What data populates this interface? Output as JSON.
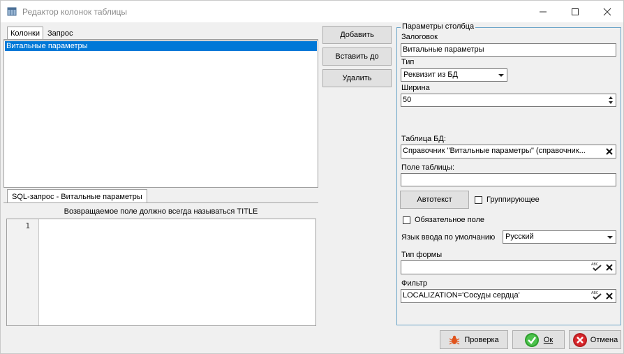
{
  "window": {
    "title": "Редактор колонок таблицы"
  },
  "left_tabs": [
    "Колонки",
    "Запрос"
  ],
  "columns_list": {
    "items": [
      "Витальные параметры"
    ]
  },
  "sql_tab": {
    "label": "SQL-запрос - Витальные параметры",
    "hint": "Возвращаемое поле должно всегда называться TITLE",
    "line_number": "1",
    "code": ""
  },
  "middle_buttons": {
    "add": "Добавить",
    "insert_before": "Вставить до",
    "delete": "Удалить"
  },
  "params": {
    "group_title": "Параметры столбца",
    "header_label": "Залоговок",
    "header_value": "Витальные параметры",
    "type_label": "Тип",
    "type_value": "Реквизит из БД",
    "width_label": "Ширина",
    "width_value": "50",
    "db_table_label": "Таблица БД:",
    "db_table_value": "Справочник \"Витальные параметры\" (справочник...",
    "table_field_label": "Поле таблицы:",
    "table_field_value": "",
    "autotext_button": "Автотекст",
    "grouping_label": "Группирующее",
    "grouping_checked": false,
    "required_label": "Обязательное поле",
    "required_checked": false,
    "input_lang_label": "Язык ввода по умолчанию",
    "input_lang_value": "Русский",
    "form_type_label": "Тип формы",
    "form_type_value": "",
    "filter_label": "Фильтр",
    "filter_value": "LOCALIZATION='Сосуды сердца'"
  },
  "bottom_buttons": {
    "check": "Проверка",
    "ok": "Ок",
    "cancel": "Отмена"
  },
  "colors": {
    "selection": "#0078d7",
    "group_border": "#6aa4c8",
    "ok_green": "#2e9e2e",
    "cancel_red": "#d9262b",
    "bug_orange": "#e0531c"
  }
}
